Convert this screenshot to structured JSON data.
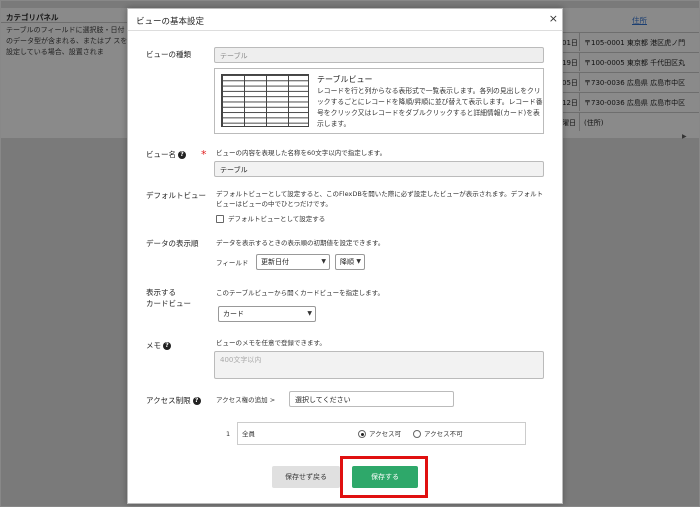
{
  "background": {
    "left_panel_title": "カテゴリパネル",
    "left_panel_text": "テーブルのフィールドに選択肢・日付のデータ型が含まれる、またはプ スを設定している場合、設置されま",
    "right_header": "住所",
    "rows": [
      {
        "num": "01日",
        "addr": "〒105-0001 東京都 港区虎ノ門"
      },
      {
        "num": "19日",
        "addr": "〒100-0005 東京都 千代田区丸"
      },
      {
        "num": "05日",
        "addr": "〒730-0036 広島県 広島市中区"
      },
      {
        "num": "12日",
        "addr": "〒730-0036 広島県 広島市中区"
      },
      {
        "num": "曜日",
        "addr": "(住所)"
      }
    ]
  },
  "modal": {
    "title": "ビューの基本設定",
    "close": "×",
    "view_type": {
      "label": "ビューの種類",
      "value": "テーブル",
      "preview_title": "テーブルビュー",
      "preview_desc": "レコードを行と列からなる表形式で一覧表示します。各列の見出しをクリックするごとにレコードを降順/昇順に並び替えて表示します。レコード番号をクリック又はレコードをダブルクリックすると詳細情報(カード)を表示します。"
    },
    "view_name": {
      "label": "ビュー名",
      "help": "?",
      "required": "*",
      "hint": "ビューの内容を表現した名称を60文字以内で指定します。",
      "value": "テーブル"
    },
    "default_view": {
      "label": "デフォルトビュー",
      "hint": "デフォルトビューとして設定すると、このFlexDBを開いた際に必ず設定したビューが表示されます。デフォルトビューはビューの中でひとつだけです。",
      "checkbox_label": "デフォルトビューとして設定する"
    },
    "display_order": {
      "label": "データの表示順",
      "hint": "データを表示するときの表示順の初期値を設定できます。",
      "field_label": "フィールド",
      "field_value": "更新日付",
      "order_value": "降順"
    },
    "card_view": {
      "label_line1": "表示する",
      "label_line2": "カードビュー",
      "hint": "このテーブルビューから開くカードビューを指定します。",
      "value": "カード"
    },
    "memo": {
      "label": "メモ",
      "hint": "ビューのメモを任意で登録できます。",
      "placeholder": "400文字以内"
    },
    "access": {
      "label": "アクセス制限",
      "add_label": "アクセス権の追加 >",
      "select_placeholder": "選択してください",
      "row_num": "1",
      "row_name": "全員",
      "allow_label": "アクセス可",
      "deny_label": "アクセス不可"
    },
    "buttons": {
      "cancel": "保存せず戻る",
      "save": "保存する"
    }
  }
}
